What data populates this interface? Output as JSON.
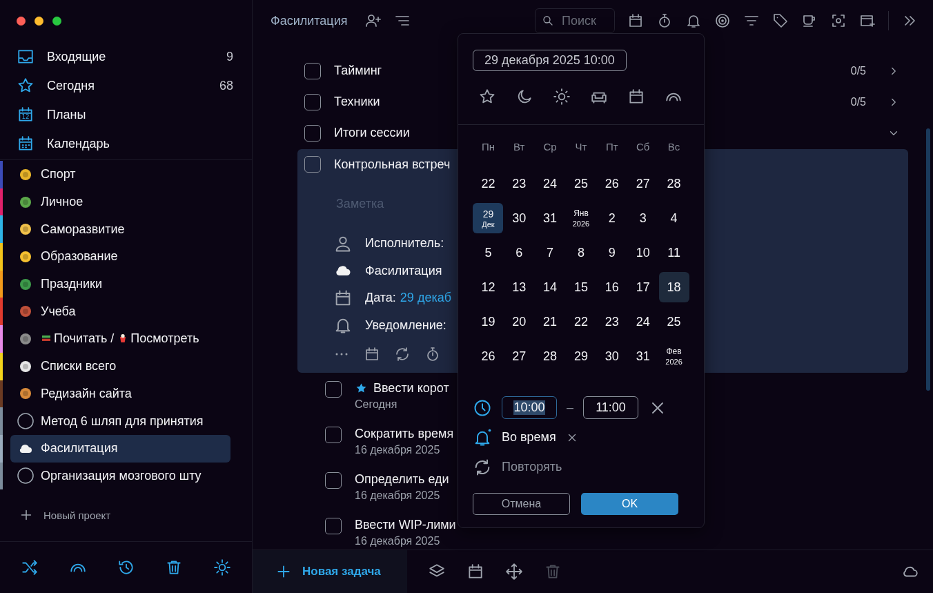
{
  "sidebar": {
    "nav": [
      {
        "label": "Входящие",
        "count": "9"
      },
      {
        "label": "Сегодня",
        "count": "68"
      },
      {
        "label": "Планы",
        "icon_text": "12"
      },
      {
        "label": "Календарь"
      }
    ],
    "projects": [
      {
        "label": "Спорт",
        "kind": "emoji",
        "color": "#3b4bb8",
        "selected": false
      },
      {
        "label": "Личное",
        "kind": "emoji",
        "color": "#e0206a",
        "selected": false
      },
      {
        "label": "Саморазвитие",
        "kind": "emoji",
        "color": "#2fb3e6",
        "selected": false
      },
      {
        "label": "Образование",
        "kind": "emoji",
        "color": "#f2c31b",
        "selected": false
      },
      {
        "label": "Праздники",
        "kind": "emoji",
        "color": "#f29a1b",
        "selected": false
      },
      {
        "label": "Учеба",
        "kind": "emoji",
        "color": "#e03a2e",
        "selected": false
      },
      {
        "label": "Почитать /",
        "label_2": "Посмотреть",
        "kind": "emoji",
        "color": "#e88ae8",
        "selected": false
      },
      {
        "label": "Списки всего",
        "kind": "emoji",
        "color": "#f2d21b",
        "selected": false
      },
      {
        "label": "Редизайн сайта",
        "kind": "emoji",
        "color": "#6b3a22",
        "selected": false
      },
      {
        "label": "Метод 6 шляп для принятия",
        "kind": "circle",
        "color": "#7c8c9c",
        "selected": false
      },
      {
        "label": "Фасилитация",
        "kind": "cloud",
        "color": "#9aabbd",
        "selected": true
      },
      {
        "label": "Организация мозгового шту",
        "kind": "circle",
        "color": "#7c8c9c",
        "selected": false
      }
    ],
    "new_project": "Новый проект"
  },
  "header": {
    "title": "Фасилитация",
    "search_placeholder": "Поиск"
  },
  "tasks": [
    {
      "title": "Тайминг",
      "progress": "0/5",
      "checked": false,
      "expanded": false
    },
    {
      "title": "Техники",
      "progress": "0/5",
      "checked": false,
      "expanded": false
    },
    {
      "title": "Итоги сессии",
      "checked": false,
      "expanded": true
    }
  ],
  "card": {
    "title": "Контрольная встреч",
    "checked": false,
    "note_placeholder": "Заметка",
    "details": [
      {
        "kind": "assignee",
        "label": "Исполнитель:"
      },
      {
        "kind": "project",
        "label": "Фасилитация"
      },
      {
        "kind": "date",
        "label": "Дата:",
        "value": "29 декаб"
      },
      {
        "kind": "reminder",
        "label": "Уведомление:"
      }
    ]
  },
  "subtasks": [
    {
      "title": "Ввести корот",
      "starred": true,
      "date": "Сегодня",
      "checked": false
    },
    {
      "title": "Сократить время",
      "starred": false,
      "date": "16 декабря 2025",
      "checked": false
    },
    {
      "title": "Определить еди",
      "starred": false,
      "date": "16 декабря 2025",
      "checked": false
    },
    {
      "title": "Ввести WIP-лими",
      "starred": false,
      "date": "16 декабря 2025",
      "checked": false
    }
  ],
  "bottom_bar": {
    "new_task": "Новая задача",
    "delete_disabled": true
  },
  "picker": {
    "date_field": "29 декабря 2025 10:00",
    "weekdays": [
      "Пн",
      "Вт",
      "Ср",
      "Чт",
      "Пт",
      "Сб",
      "Вс"
    ],
    "weeks": [
      [
        {
          "kind": "day",
          "d": "22",
          "selected": false,
          "today": false
        },
        {
          "kind": "day",
          "d": "23",
          "selected": false,
          "today": false
        },
        {
          "kind": "day",
          "d": "24",
          "selected": false,
          "today": false
        },
        {
          "kind": "day",
          "d": "25",
          "selected": false,
          "today": false
        },
        {
          "kind": "day",
          "d": "26",
          "selected": false,
          "today": false
        },
        {
          "kind": "day",
          "d": "27",
          "selected": false,
          "today": false
        },
        {
          "kind": "day",
          "d": "28",
          "selected": false,
          "today": false
        }
      ],
      [
        {
          "kind": "month",
          "d": "29",
          "sub": "Дек",
          "selected": true,
          "today": false
        },
        {
          "kind": "day",
          "d": "30",
          "selected": false,
          "today": false
        },
        {
          "kind": "day",
          "d": "31",
          "selected": false,
          "today": false
        },
        {
          "kind": "month",
          "d": "Янв",
          "sub": "2026",
          "selected": false,
          "today": false
        },
        {
          "kind": "day",
          "d": "2",
          "selected": false,
          "today": false
        },
        {
          "kind": "day",
          "d": "3",
          "selected": false,
          "today": false
        },
        {
          "kind": "day",
          "d": "4",
          "selected": false,
          "today": false
        }
      ],
      [
        {
          "kind": "day",
          "d": "5",
          "selected": false,
          "today": false
        },
        {
          "kind": "day",
          "d": "6",
          "selected": false,
          "today": false
        },
        {
          "kind": "day",
          "d": "7",
          "selected": false,
          "today": false
        },
        {
          "kind": "day",
          "d": "8",
          "selected": false,
          "today": false
        },
        {
          "kind": "day",
          "d": "9",
          "selected": false,
          "today": false
        },
        {
          "kind": "day",
          "d": "10",
          "selected": false,
          "today": false
        },
        {
          "kind": "day",
          "d": "11",
          "selected": false,
          "today": false
        }
      ],
      [
        {
          "kind": "day",
          "d": "12",
          "selected": false,
          "today": false
        },
        {
          "kind": "day",
          "d": "13",
          "selected": false,
          "today": false
        },
        {
          "kind": "day",
          "d": "14",
          "selected": false,
          "today": false
        },
        {
          "kind": "day",
          "d": "15",
          "selected": false,
          "today": false
        },
        {
          "kind": "day",
          "d": "16",
          "selected": false,
          "today": false
        },
        {
          "kind": "day",
          "d": "17",
          "selected": false,
          "today": false
        },
        {
          "kind": "day",
          "d": "18",
          "selected": false,
          "today": true
        }
      ],
      [
        {
          "kind": "day",
          "d": "19",
          "selected": false,
          "today": false
        },
        {
          "kind": "day",
          "d": "20",
          "selected": false,
          "today": false
        },
        {
          "kind": "day",
          "d": "21",
          "selected": false,
          "today": false
        },
        {
          "kind": "day",
          "d": "22",
          "selected": false,
          "today": false
        },
        {
          "kind": "day",
          "d": "23",
          "selected": false,
          "today": false
        },
        {
          "kind": "day",
          "d": "24",
          "selected": false,
          "today": false
        },
        {
          "kind": "day",
          "d": "25",
          "selected": false,
          "today": false
        }
      ],
      [
        {
          "kind": "day",
          "d": "26",
          "selected": false,
          "today": false
        },
        {
          "kind": "day",
          "d": "27",
          "selected": false,
          "today": false
        },
        {
          "kind": "day",
          "d": "28",
          "selected": false,
          "today": false
        },
        {
          "kind": "day",
          "d": "29",
          "selected": false,
          "today": false
        },
        {
          "kind": "day",
          "d": "30",
          "selected": false,
          "today": false
        },
        {
          "kind": "day",
          "d": "31",
          "selected": false,
          "today": false
        },
        {
          "kind": "month",
          "d": "Фев",
          "sub": "2026",
          "selected": false,
          "today": false
        }
      ]
    ],
    "time_from": {
      "value": "10:00",
      "focused": true
    },
    "dash": "–",
    "time_to": {
      "value": "11:00",
      "focused": false
    },
    "reminder": {
      "label": "Во время",
      "on": true
    },
    "repeat": {
      "label": "Повторять",
      "on": false
    },
    "cancel": "Отмена",
    "ok": "OK"
  }
}
